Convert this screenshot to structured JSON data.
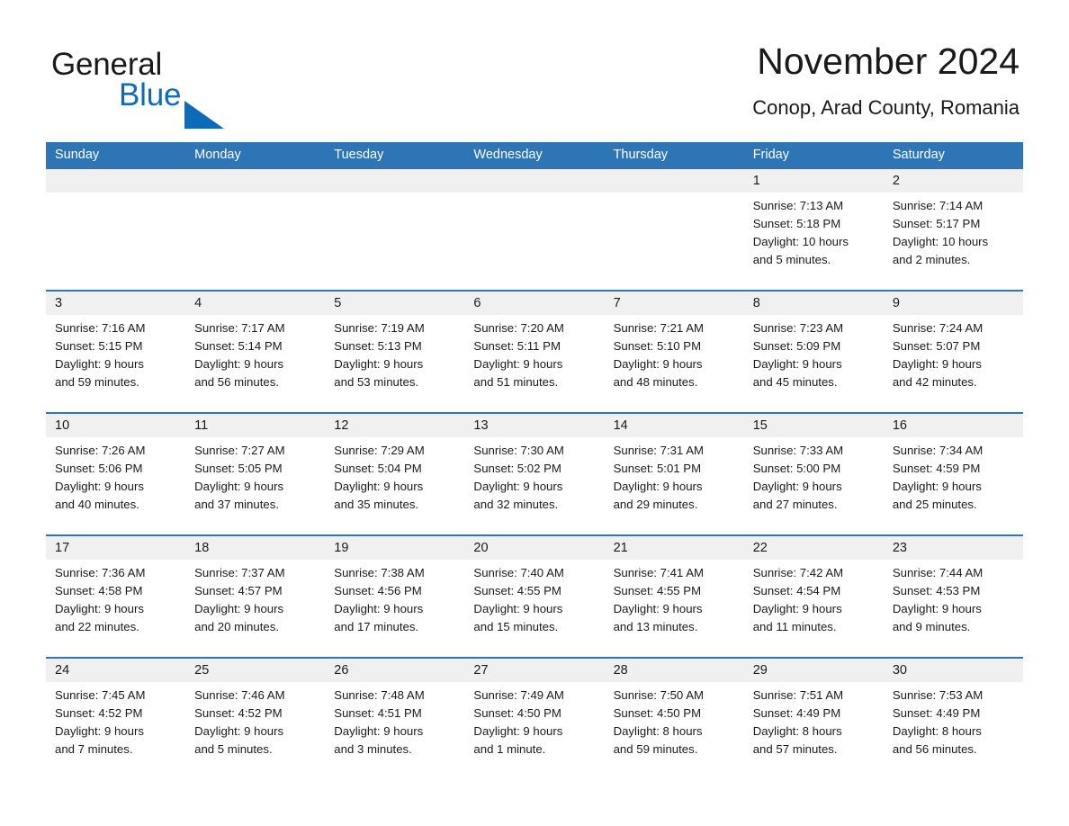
{
  "logo": {
    "text_general": "General",
    "text_blue": "Blue",
    "triangle_color": "#0d6cb9",
    "general_color": "#1a1a1a"
  },
  "header": {
    "title": "November 2024",
    "subtitle": "Conop, Arad County, Romania",
    "header_bg": "#2e75b6",
    "daterow_bg": "#f0f0f0"
  },
  "weekdays": [
    "Sunday",
    "Monday",
    "Tuesday",
    "Wednesday",
    "Thursday",
    "Friday",
    "Saturday"
  ],
  "weeks": [
    {
      "dates": [
        "",
        "",
        "",
        "",
        "",
        "1",
        "2"
      ],
      "cells": [
        {
          "l1": "",
          "l2": "",
          "l3": "",
          "l4": ""
        },
        {
          "l1": "",
          "l2": "",
          "l3": "",
          "l4": ""
        },
        {
          "l1": "",
          "l2": "",
          "l3": "",
          "l4": ""
        },
        {
          "l1": "",
          "l2": "",
          "l3": "",
          "l4": ""
        },
        {
          "l1": "",
          "l2": "",
          "l3": "",
          "l4": ""
        },
        {
          "l1": "Sunrise: 7:13 AM",
          "l2": "Sunset: 5:18 PM",
          "l3": "Daylight: 10 hours",
          "l4": "and 5 minutes."
        },
        {
          "l1": "Sunrise: 7:14 AM",
          "l2": "Sunset: 5:17 PM",
          "l3": "Daylight: 10 hours",
          "l4": "and 2 minutes."
        }
      ]
    },
    {
      "dates": [
        "3",
        "4",
        "5",
        "6",
        "7",
        "8",
        "9"
      ],
      "cells": [
        {
          "l1": "Sunrise: 7:16 AM",
          "l2": "Sunset: 5:15 PM",
          "l3": "Daylight: 9 hours",
          "l4": "and 59 minutes."
        },
        {
          "l1": "Sunrise: 7:17 AM",
          "l2": "Sunset: 5:14 PM",
          "l3": "Daylight: 9 hours",
          "l4": "and 56 minutes."
        },
        {
          "l1": "Sunrise: 7:19 AM",
          "l2": "Sunset: 5:13 PM",
          "l3": "Daylight: 9 hours",
          "l4": "and 53 minutes."
        },
        {
          "l1": "Sunrise: 7:20 AM",
          "l2": "Sunset: 5:11 PM",
          "l3": "Daylight: 9 hours",
          "l4": "and 51 minutes."
        },
        {
          "l1": "Sunrise: 7:21 AM",
          "l2": "Sunset: 5:10 PM",
          "l3": "Daylight: 9 hours",
          "l4": "and 48 minutes."
        },
        {
          "l1": "Sunrise: 7:23 AM",
          "l2": "Sunset: 5:09 PM",
          "l3": "Daylight: 9 hours",
          "l4": "and 45 minutes."
        },
        {
          "l1": "Sunrise: 7:24 AM",
          "l2": "Sunset: 5:07 PM",
          "l3": "Daylight: 9 hours",
          "l4": "and 42 minutes."
        }
      ]
    },
    {
      "dates": [
        "10",
        "11",
        "12",
        "13",
        "14",
        "15",
        "16"
      ],
      "cells": [
        {
          "l1": "Sunrise: 7:26 AM",
          "l2": "Sunset: 5:06 PM",
          "l3": "Daylight: 9 hours",
          "l4": "and 40 minutes."
        },
        {
          "l1": "Sunrise: 7:27 AM",
          "l2": "Sunset: 5:05 PM",
          "l3": "Daylight: 9 hours",
          "l4": "and 37 minutes."
        },
        {
          "l1": "Sunrise: 7:29 AM",
          "l2": "Sunset: 5:04 PM",
          "l3": "Daylight: 9 hours",
          "l4": "and 35 minutes."
        },
        {
          "l1": "Sunrise: 7:30 AM",
          "l2": "Sunset: 5:02 PM",
          "l3": "Daylight: 9 hours",
          "l4": "and 32 minutes."
        },
        {
          "l1": "Sunrise: 7:31 AM",
          "l2": "Sunset: 5:01 PM",
          "l3": "Daylight: 9 hours",
          "l4": "and 29 minutes."
        },
        {
          "l1": "Sunrise: 7:33 AM",
          "l2": "Sunset: 5:00 PM",
          "l3": "Daylight: 9 hours",
          "l4": "and 27 minutes."
        },
        {
          "l1": "Sunrise: 7:34 AM",
          "l2": "Sunset: 4:59 PM",
          "l3": "Daylight: 9 hours",
          "l4": "and 25 minutes."
        }
      ]
    },
    {
      "dates": [
        "17",
        "18",
        "19",
        "20",
        "21",
        "22",
        "23"
      ],
      "cells": [
        {
          "l1": "Sunrise: 7:36 AM",
          "l2": "Sunset: 4:58 PM",
          "l3": "Daylight: 9 hours",
          "l4": "and 22 minutes."
        },
        {
          "l1": "Sunrise: 7:37 AM",
          "l2": "Sunset: 4:57 PM",
          "l3": "Daylight: 9 hours",
          "l4": "and 20 minutes."
        },
        {
          "l1": "Sunrise: 7:38 AM",
          "l2": "Sunset: 4:56 PM",
          "l3": "Daylight: 9 hours",
          "l4": "and 17 minutes."
        },
        {
          "l1": "Sunrise: 7:40 AM",
          "l2": "Sunset: 4:55 PM",
          "l3": "Daylight: 9 hours",
          "l4": "and 15 minutes."
        },
        {
          "l1": "Sunrise: 7:41 AM",
          "l2": "Sunset: 4:55 PM",
          "l3": "Daylight: 9 hours",
          "l4": "and 13 minutes."
        },
        {
          "l1": "Sunrise: 7:42 AM",
          "l2": "Sunset: 4:54 PM",
          "l3": "Daylight: 9 hours",
          "l4": "and 11 minutes."
        },
        {
          "l1": "Sunrise: 7:44 AM",
          "l2": "Sunset: 4:53 PM",
          "l3": "Daylight: 9 hours",
          "l4": "and 9 minutes."
        }
      ]
    },
    {
      "dates": [
        "24",
        "25",
        "26",
        "27",
        "28",
        "29",
        "30"
      ],
      "cells": [
        {
          "l1": "Sunrise: 7:45 AM",
          "l2": "Sunset: 4:52 PM",
          "l3": "Daylight: 9 hours",
          "l4": "and 7 minutes."
        },
        {
          "l1": "Sunrise: 7:46 AM",
          "l2": "Sunset: 4:52 PM",
          "l3": "Daylight: 9 hours",
          "l4": "and 5 minutes."
        },
        {
          "l1": "Sunrise: 7:48 AM",
          "l2": "Sunset: 4:51 PM",
          "l3": "Daylight: 9 hours",
          "l4": "and 3 minutes."
        },
        {
          "l1": "Sunrise: 7:49 AM",
          "l2": "Sunset: 4:50 PM",
          "l3": "Daylight: 9 hours",
          "l4": "and 1 minute."
        },
        {
          "l1": "Sunrise: 7:50 AM",
          "l2": "Sunset: 4:50 PM",
          "l3": "Daylight: 8 hours",
          "l4": "and 59 minutes."
        },
        {
          "l1": "Sunrise: 7:51 AM",
          "l2": "Sunset: 4:49 PM",
          "l3": "Daylight: 8 hours",
          "l4": "and 57 minutes."
        },
        {
          "l1": "Sunrise: 7:53 AM",
          "l2": "Sunset: 4:49 PM",
          "l3": "Daylight: 8 hours",
          "l4": "and 56 minutes."
        }
      ]
    }
  ]
}
